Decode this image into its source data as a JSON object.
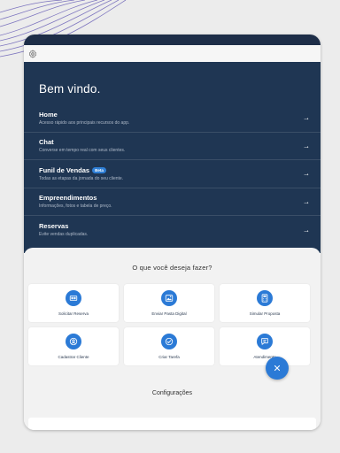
{
  "header": {
    "settings_icon": "gear-icon"
  },
  "hero": {
    "welcome": "Bem vindo.",
    "items": [
      {
        "title": "Home",
        "desc": "Acesso rápido aos principais recursos do app.",
        "badge": ""
      },
      {
        "title": "Chat",
        "desc": "Converse em tempo real com seus clientes.",
        "badge": ""
      },
      {
        "title": "Funil de Vendas",
        "desc": "Todas as etapas da jornada do seu cliente.",
        "badge": "Beta"
      },
      {
        "title": "Empreendimentos",
        "desc": "Informações, fotos e tabela de preço.",
        "badge": ""
      },
      {
        "title": "Reservas",
        "desc": "Evite vendas duplicadas.",
        "badge": ""
      }
    ]
  },
  "actions": {
    "title": "O que você deseja fazer?",
    "cards": [
      {
        "label": "Solicitar Reserva",
        "icon": "reservation-icon"
      },
      {
        "label": "Enviar Pasta Digital",
        "icon": "folder-image-icon"
      },
      {
        "label": "Simular Proposta",
        "icon": "calculator-icon"
      },
      {
        "label": "Cadastrar Cliente",
        "icon": "user-add-icon"
      },
      {
        "label": "Criar Tarefa",
        "icon": "check-circle-icon"
      },
      {
        "label": "Atendimento",
        "icon": "chat-icon"
      }
    ]
  },
  "config": {
    "title": "Configurações"
  },
  "colors": {
    "navy": "#1f3653",
    "accent": "#2b7ad6",
    "background": "#ececec"
  }
}
